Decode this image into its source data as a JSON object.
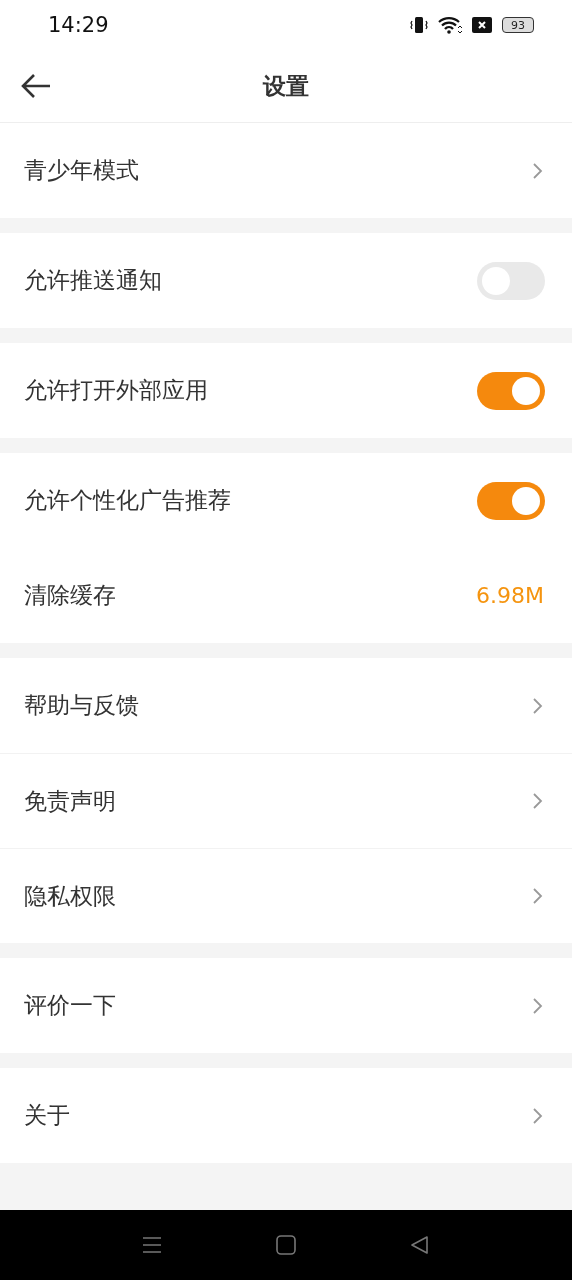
{
  "status_bar": {
    "time": "14:29",
    "battery": "93"
  },
  "header": {
    "title": "设置"
  },
  "groups": [
    {
      "rows": [
        {
          "kind": "chevron",
          "label": "青少年模式"
        }
      ]
    },
    {
      "rows": [
        {
          "kind": "toggle",
          "label": "允许推送通知",
          "on": false
        }
      ]
    },
    {
      "rows": [
        {
          "kind": "toggle",
          "label": "允许打开外部应用",
          "on": true
        }
      ]
    },
    {
      "rows": [
        {
          "kind": "toggle",
          "label": "允许个性化广告推荐",
          "on": true
        },
        {
          "kind": "value",
          "label": "清除缓存",
          "value": "6.98M"
        }
      ]
    },
    {
      "rows": [
        {
          "kind": "chevron",
          "label": "帮助与反馈"
        },
        {
          "kind": "chevron",
          "label": "免责声明"
        },
        {
          "kind": "chevron",
          "label": "隐私权限"
        }
      ]
    },
    {
      "rows": [
        {
          "kind": "chevron",
          "label": "评价一下"
        }
      ]
    },
    {
      "rows": [
        {
          "kind": "chevron",
          "label": "关于"
        }
      ]
    }
  ]
}
